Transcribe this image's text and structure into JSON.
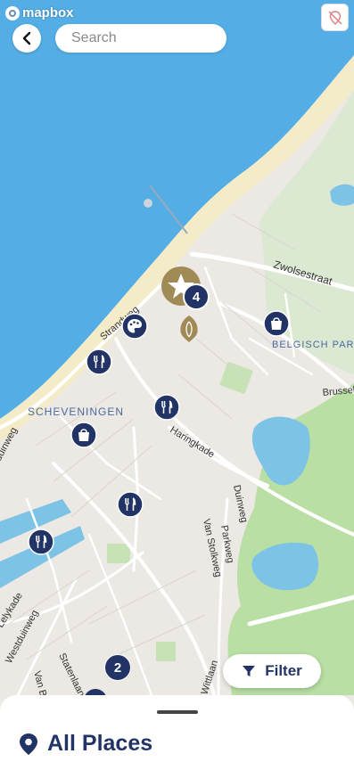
{
  "brand": {
    "logo_text": "mapbox"
  },
  "search": {
    "placeholder": "Search"
  },
  "map": {
    "labels": {
      "zwolsestraat": "Zwolsestraat",
      "strandweg": "Strandweg",
      "belgisch_park": "BELGISCH PARK",
      "brussel": "Brussel",
      "scheveningen": "SCHEVENINGEN",
      "haringkade": "Haringkade",
      "duinweg": "Duinweg",
      "van_stolkweg": "Van Stolkweg",
      "parkweg": "Parkweg",
      "lelykade": "Lelykade",
      "westduinweg": "Westduinweg",
      "statenlaan": "Statenlaan",
      "van_b": "Van B",
      "wittlaan": "Wittlaan",
      "duinweg_left": "duinweg"
    },
    "clusters": {
      "featured_count": "4",
      "bottom_count": "2"
    },
    "colors": {
      "marker": "#223465",
      "featured": "#a08a55",
      "water": "#54aee5"
    }
  },
  "filter_button": {
    "label": "Filter"
  },
  "sheet": {
    "title": "All Places"
  }
}
